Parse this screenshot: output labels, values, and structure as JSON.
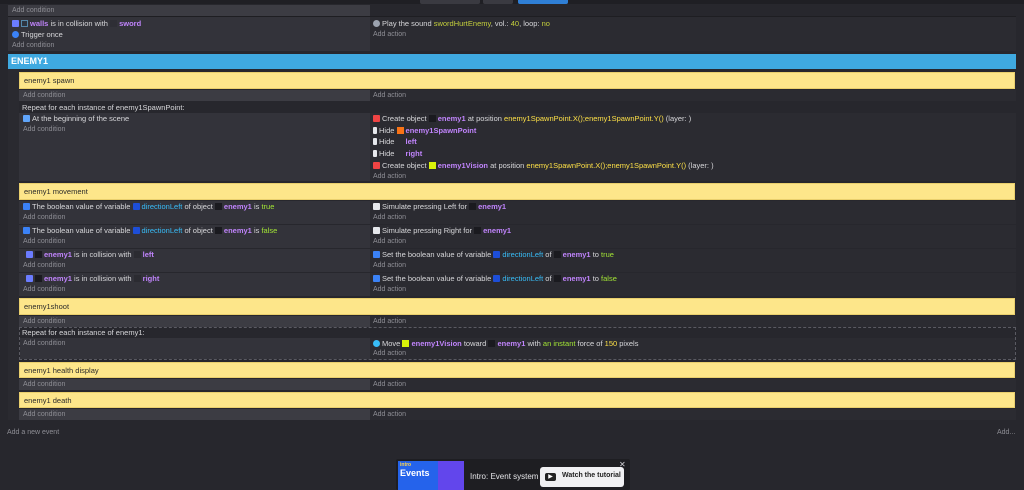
{
  "top": {
    "add_condition": "Add condition",
    "sword_event": {
      "cond_obj1": "walls",
      "cond_text": "is in collision with",
      "cond_obj2": "sword",
      "trigger": "Trigger once",
      "add_condition": "Add condition",
      "action_prefix": "Play the sound",
      "sound_name": "swordHurtEnemy",
      "vol_label": ", vol.:",
      "vol": "40",
      "loop_label": ", loop:",
      "loop": "no",
      "add_action": "Add action"
    }
  },
  "group": {
    "title": "ENEMY1"
  },
  "spawn": {
    "comment": "enemy1 spawn",
    "add_condition": "Add condition",
    "add_action": "Add action",
    "repeat": "Repeat for each instance of enemy1SpawnPoint:",
    "condition": "At the beginning of the scene",
    "add_condition2": "Add condition",
    "a1_prefix": "Create object",
    "a1_obj": "enemy1",
    "a1_mid": "at position",
    "a1_pos": "enemy1SpawnPoint.X();enemy1SpawnPoint.Y()",
    "a1_layer": "(layer: )",
    "a2_prefix": "Hide",
    "a2_obj": "enemy1SpawnPoint",
    "a3_prefix": "Hide",
    "a3_obj": "left",
    "a4_prefix": "Hide",
    "a4_obj": "right",
    "a5_prefix": "Create object",
    "a5_obj": "enemy1Vision",
    "a5_mid": "at position",
    "a5_pos": "enemy1SpawnPoint.X();enemy1SpawnPoint.Y()",
    "a5_layer": "(layer: )"
  },
  "movement": {
    "comment": "enemy1 movement",
    "e1": {
      "c_prefix": "The boolean value of variable",
      "c_var": "directionLeft",
      "c_mid": "of object",
      "c_obj": "enemy1",
      "c_is": "is",
      "c_val": "true",
      "add_condition": "Add condition",
      "a_prefix": "Simulate pressing Left for",
      "a_obj": "enemy1",
      "add_action": "Add action"
    },
    "e2": {
      "c_prefix": "The boolean value of variable",
      "c_var": "directionLeft",
      "c_mid": "of object",
      "c_obj": "enemy1",
      "c_is": "is",
      "c_val": "false",
      "add_condition": "Add condition",
      "a_prefix": "Simulate pressing Right for",
      "a_obj": "enemy1",
      "add_action": "Add action"
    },
    "e3": {
      "c_obj1": "enemy1",
      "c_text": "is in collision with",
      "c_obj2": "left",
      "add_condition": "Add condition",
      "a_prefix": "Set the boolean value of variable",
      "a_var": "directionLeft",
      "a_of": "of",
      "a_obj": "enemy1",
      "a_to": "to",
      "a_val": "true",
      "add_action": "Add action"
    },
    "e4": {
      "c_obj1": "enemy1",
      "c_text": "is in collision with",
      "c_obj2": "right",
      "add_condition": "Add condition",
      "a_prefix": "Set the boolean value of variable",
      "a_var": "directionLeft",
      "a_of": "of",
      "a_obj": "enemy1",
      "a_to": "to",
      "a_val": "false",
      "add_action": "Add action"
    }
  },
  "shoot": {
    "comment": "enemy1shoot",
    "add_condition": "Add condition",
    "add_action": "Add action",
    "repeat": "Repeat for each instance of enemy1:",
    "add_condition2": "Add condition",
    "a_prefix": "Move",
    "a_obj": "enemy1Vision",
    "a_mid": "toward",
    "a_obj2": "enemy1",
    "a_with": "with",
    "a_force": "an instant",
    "a_force_of": "force of",
    "a_num": "150",
    "a_unit": "pixels",
    "add_action2": "Add action"
  },
  "health": {
    "comment": "enemy1 health display",
    "add_condition": "Add condition",
    "add_action": "Add action"
  },
  "death": {
    "comment": "enemy1 death",
    "add_condition": "Add condition",
    "add_action": "Add action"
  },
  "footer": {
    "add_event": "Add a new event",
    "add_more": "Add..."
  },
  "tutorial": {
    "thumb_tag": "intro",
    "thumb_title": "Events",
    "label": "Intro: Event system",
    "button": "Watch the tutorial",
    "close": "✕"
  },
  "colors": {
    "group": "#3fa9e0",
    "comment": "#fde68a",
    "object_name": "#c084fc",
    "variable": "#38bdf8",
    "true_false": "#a3e635"
  }
}
